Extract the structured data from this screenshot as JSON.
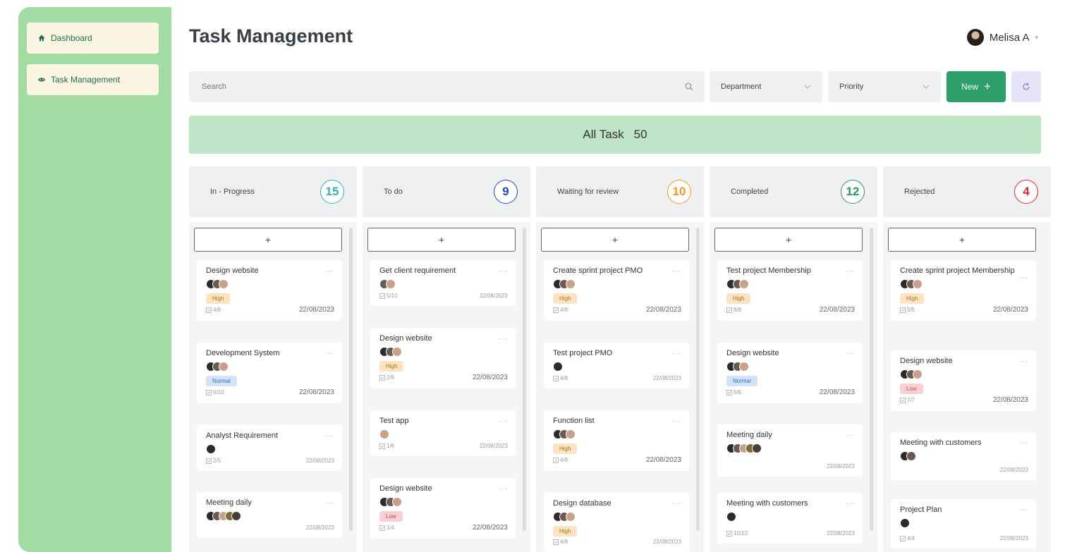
{
  "sidebar": {
    "items": [
      {
        "label": "Dashboard",
        "icon": "home-icon"
      },
      {
        "label": "Task Management",
        "icon": "eye-icon"
      }
    ]
  },
  "header": {
    "title": "Task Management",
    "user_name": "Melisa A"
  },
  "toolbar": {
    "search_placeholder": "Search",
    "department_label": "Department",
    "priority_label": "Priority",
    "new_label": "New"
  },
  "summary": {
    "label": "All Task",
    "count": "50"
  },
  "colors": {
    "sidebar": "#a3dca3",
    "primary": "#2e9e6b",
    "count_in_progress": "#2bb6b0",
    "count_todo": "#2a47c9",
    "count_waiting": "#f29a1b",
    "count_completed": "#2a9a55",
    "count_rejected": "#e0262b"
  },
  "columns": [
    {
      "title": "In - Progress",
      "count": "15",
      "cards": [
        {
          "title": "Design website",
          "tag": "High",
          "sub": "4/8",
          "date": "22/08/2023"
        },
        {
          "title": "Development System",
          "tag": "Normal",
          "sub": "6/10",
          "date": "22/08/2023"
        },
        {
          "title": "Analyst Requirement",
          "sub": "2/5",
          "date": "22/08/2023"
        },
        {
          "title": "Meeting daily",
          "date": "22/08/2023"
        }
      ]
    },
    {
      "title": "To do",
      "count": "9",
      "cards": [
        {
          "title": "Get client requirement",
          "sub": "5/10",
          "date": "22/08/2023"
        },
        {
          "title": "Design website",
          "tag": "High",
          "sub": "2/8",
          "date": "22/08/2023"
        },
        {
          "title": "Test app",
          "sub": "1/6",
          "date": "22/08/2023"
        },
        {
          "title": "Design website",
          "tag": "Low",
          "sub": "1/4",
          "date": "22/08/2023"
        }
      ]
    },
    {
      "title": "Waiting for review",
      "count": "10",
      "cards": [
        {
          "title": "Create sprint project PMO",
          "tag": "High",
          "sub": "4/8",
          "date": "22/08/2023"
        },
        {
          "title": "Test project PMO",
          "sub": "4/8",
          "date": "22/08/2023"
        },
        {
          "title": "Function list",
          "tag": "High",
          "sub": "4/8",
          "date": "22/08/2023"
        },
        {
          "title": "Design database",
          "tag": "High",
          "sub": "4/8",
          "date": "22/08/2023"
        }
      ]
    },
    {
      "title": "Completed",
      "count": "12",
      "cards": [
        {
          "title": "Test project Membership",
          "tag": "High",
          "sub": "8/8",
          "date": "22/08/2023"
        },
        {
          "title": "Design website",
          "tag": "Normal",
          "sub": "6/6",
          "date": "22/08/2023"
        },
        {
          "title": "Meeting daily",
          "date": "22/08/2023"
        },
        {
          "title": "Meeting with customers",
          "sub": "10/10",
          "date": "22/08/2023"
        }
      ]
    },
    {
      "title": "Rejected",
      "count": "4",
      "cards": [
        {
          "title": "Create sprint project Membership",
          "tag": "High",
          "sub": "5/5",
          "date": "22/08/2023"
        },
        {
          "title": "Design website",
          "tag": "Low",
          "sub": "7/7",
          "date": "22/08/2023"
        },
        {
          "title": "Meeting with customers",
          "date": "22/08/2023"
        },
        {
          "title": "Project Plan",
          "sub": "4/4",
          "date": "22/08/2023"
        }
      ]
    }
  ]
}
